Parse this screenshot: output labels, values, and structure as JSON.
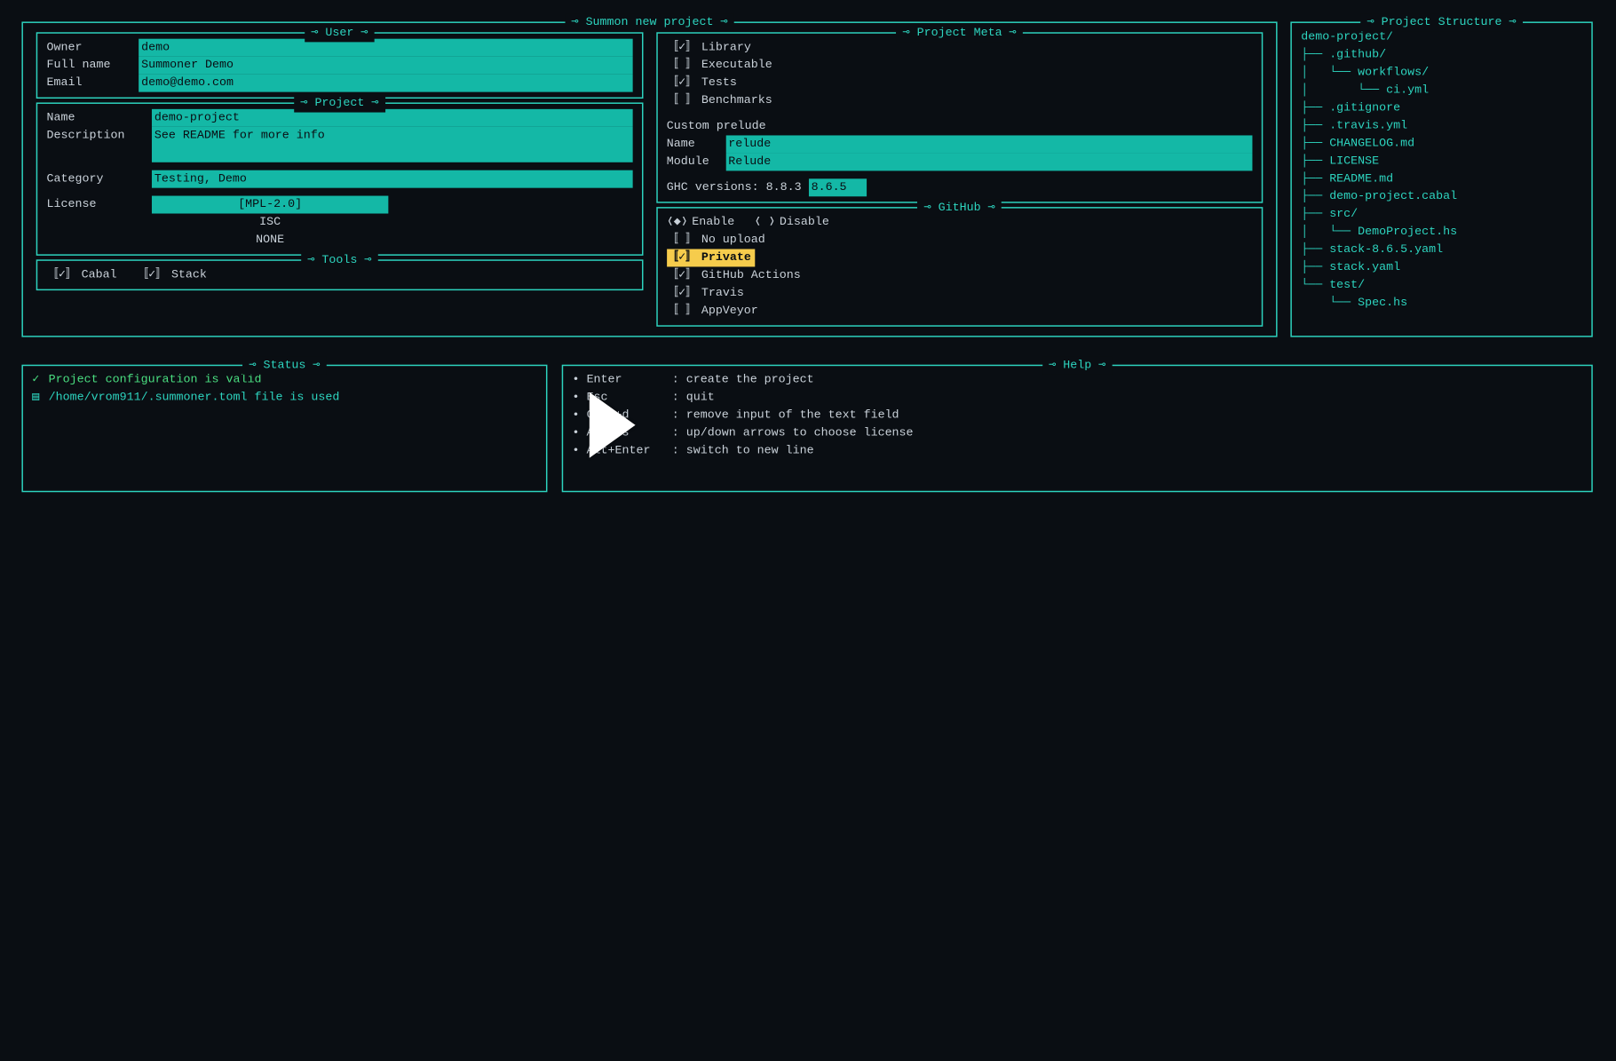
{
  "main_title": "⊸ Summon new project ⊸",
  "user": {
    "title": "⊸ User ⊸",
    "owner_label": "Owner",
    "owner_value": "demo",
    "fullname_label": "Full name",
    "fullname_value": "Summoner Demo",
    "email_label": "Email",
    "email_value": "demo@demo.com"
  },
  "project": {
    "title": "⊸ Project ⊸",
    "name_label": "Name",
    "name_value": "demo-project",
    "desc_label": "Description",
    "desc_value": "See README for more info",
    "category_label": "Category",
    "category_value": "Testing, Demo",
    "license_label": "License",
    "license_selected": "[MPL-2.0]",
    "license_opts": [
      "ISC",
      "NONE"
    ]
  },
  "tools": {
    "title": "⊸ Tools ⊸",
    "cabal": "Cabal",
    "stack": "Stack"
  },
  "meta": {
    "title": "⊸ Project Meta ⊸",
    "library": "Library",
    "executable": "Executable",
    "tests": "Tests",
    "benchmarks": "Benchmarks",
    "custom_prelude": "Custom prelude",
    "name_label": "Name",
    "name_value": "relude",
    "module_label": "Module",
    "module_value": "Relude",
    "ghc_label": "GHC versions: 8.8.3",
    "ghc_input": "8.6.5"
  },
  "github": {
    "title": "⊸ GitHub ⊸",
    "enable": "Enable",
    "disable": "Disable",
    "no_upload": "No upload",
    "private": "Private",
    "actions": "GitHub Actions",
    "travis": "Travis",
    "appveyor": "AppVeyor"
  },
  "structure": {
    "title": "⊸ Project Structure ⊸",
    "lines": [
      "demo-project/",
      "├── .github/",
      "│   └── workflows/",
      "│       └── ci.yml",
      "├── .gitignore",
      "├── .travis.yml",
      "├── CHANGELOG.md",
      "├── LICENSE",
      "├── README.md",
      "├── demo-project.cabal",
      "├── src/",
      "│   └── DemoProject.hs",
      "├── stack-8.6.5.yaml",
      "├── stack.yaml",
      "└── test/",
      "    └── Spec.hs"
    ]
  },
  "status": {
    "title": "⊸ Status ⊸",
    "line1": "Project configuration is valid",
    "line2": "/home/vrom911/.summoner.toml file is used"
  },
  "help": {
    "title": "⊸ Help ⊸",
    "items": [
      {
        "key": "Enter",
        "desc": "create the project"
      },
      {
        "key": "Esc",
        "desc": "quit"
      },
      {
        "key": "Ctrl+d",
        "desc": "remove input of the text field"
      },
      {
        "key": "Arrows",
        "desc": "up/down arrows to choose license"
      },
      {
        "key": "Alt+Enter",
        "desc": "switch to new line"
      }
    ]
  },
  "glyphs": {
    "check_on": "〚✓〛",
    "check_off": "〚 〛",
    "radio_on": "❬◆❭",
    "radio_off": "❬ ❭",
    "bullet": "•",
    "tick": "✓",
    "info": "▤"
  }
}
